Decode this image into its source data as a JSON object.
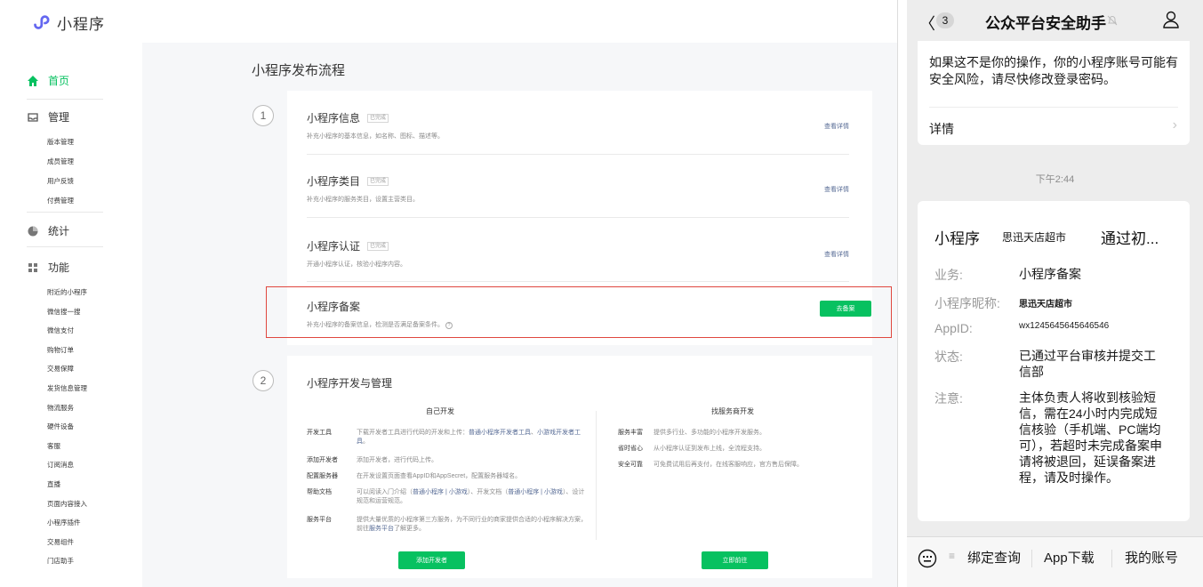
{
  "console": {
    "logo_text": "小程序",
    "page_title": "小程序发布流程",
    "sidebar": {
      "home": "首页",
      "manage": "管理",
      "manage_items": [
        "版本管理",
        "成员管理",
        "用户反馈",
        "付费管理"
      ],
      "stats": "统计",
      "features": "功能",
      "feature_items": [
        "附近的小程序",
        "微信搜一搜",
        "微信支付",
        "购物订单",
        "交易保障",
        "发货信息管理",
        "物流服务",
        "硬件设备",
        "客服",
        "订阅消息",
        "直播",
        "页面内容接入",
        "小程序插件",
        "交易组件",
        "门店助手"
      ]
    },
    "step1_number": "1",
    "step2_number": "2",
    "steps": [
      {
        "title": "小程序信息",
        "tag": "已完成",
        "desc": "补充小程序的基本信息，如名称、图标、描述等。",
        "link": "查看详情"
      },
      {
        "title": "小程序类目",
        "tag": "已完成",
        "desc": "补充小程序的服务类目，设置主营类目。",
        "link": "查看详情"
      },
      {
        "title": "小程序认证",
        "tag": "已完成",
        "desc": "开通小程序认证，核验小程序内容。",
        "link": "查看详情"
      }
    ],
    "beian": {
      "title": "小程序备案",
      "desc": "补充小程序的备案信息，检测是否满足备案条件。",
      "help_icon": "question-circle-icon",
      "button": "去备案"
    },
    "dev": {
      "title": "小程序开发与管理",
      "self_head": "自己开发",
      "service_head": "找服务商开发",
      "self_rows": [
        {
          "k": "开发工具",
          "v1": "下载开发者工具进行代码的开发和上传：",
          "a1": "普通小程序开发者工具",
          "v2": "、",
          "a2": "小游戏开发者工具",
          "v3": "。"
        },
        {
          "k": "添加开发者",
          "v1": "添加开发者，进行代码上传。",
          "a1": "",
          "v2": "",
          "a2": "",
          "v3": ""
        },
        {
          "k": "配置服务器",
          "v1": "在开发设置页面查看AppID和AppSecret，配置服务器域名。",
          "a1": "",
          "v2": "",
          "a2": "",
          "v3": ""
        },
        {
          "k": "帮助文档",
          "v1": "可以阅读入门介绍（",
          "a1": "普通小程序 | 小游戏",
          "v2": "）、开发文档（",
          "a2": "普通小程序 | 小游戏",
          "v3": "）、设计规范和运营规范。"
        },
        {
          "k": "服务平台",
          "v1": "提供大量优质的小程序第三方服务，为不同行业的商家提供合适的小程序解决方案，前往",
          "a1": "服务平台",
          "v2": "了解更多。",
          "a2": "",
          "v3": ""
        }
      ],
      "service_rows": [
        {
          "k": "服务丰富",
          "v": "提供多行业、多功能的小程序开发服务。"
        },
        {
          "k": "省时省心",
          "v": "从小程序认证到发布上线，全流程支持。"
        },
        {
          "k": "安全可靠",
          "v": "可免费试用后再支付，在线客服响应，官方售后保障。"
        }
      ],
      "btn_add_dev": "添加开发者",
      "btn_go": "立即前往"
    },
    "colors": {
      "accent": "#07c160",
      "link": "#576b95",
      "highlight": "#e0473f"
    }
  },
  "phone": {
    "unread": "3",
    "title": "公众平台安全助手",
    "msg1": {
      "text": "如果这不是你的操作，你的小程序账号可能有安全风险，请尽快修改登录密码。",
      "detail": "详情"
    },
    "time": "下午2:44",
    "msg2": {
      "title": "小程序",
      "store": "思迅天店超市",
      "status_short": "通过初...",
      "rows": [
        {
          "k": "业务:",
          "v": "小程序备案"
        },
        {
          "k": "小程序昵称:",
          "v": "思迅天店超市"
        },
        {
          "k": "AppID:",
          "v": "wx1245645645646546"
        },
        {
          "k": "状态:",
          "v": "已通过平台审核并提交工信部"
        },
        {
          "k": "注意:",
          "v": "主体负责人将收到核验短信，需在24小时内完成短信核验（手机端、PC端均可），若超时未完成备案申请将被退回，延误备案进程，请及时操作。"
        }
      ]
    },
    "menu": [
      "绑定查询",
      "App下载",
      "我的账号"
    ],
    "menu_icon": "≡"
  }
}
